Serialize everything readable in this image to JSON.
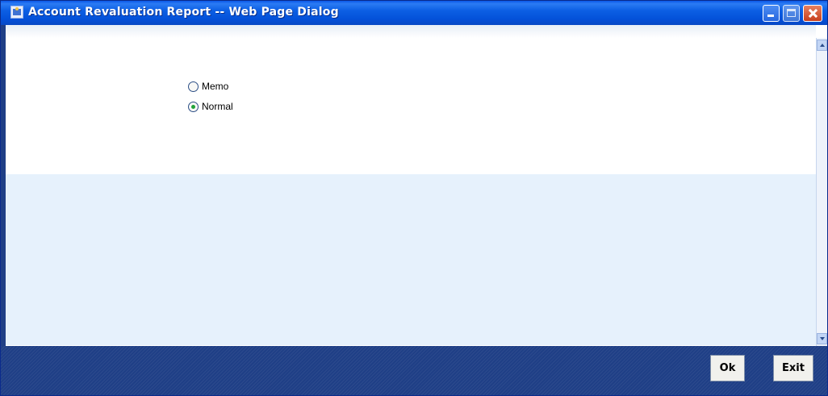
{
  "window": {
    "title": "Account Revaluation Report -- Web Page Dialog"
  },
  "options": [
    {
      "label": "Memo",
      "checked": false
    },
    {
      "label": "Normal",
      "checked": true
    }
  ],
  "footer": {
    "ok_label": "Ok",
    "exit_label": "Exit"
  },
  "colors": {
    "titlebar": "#0a58e8",
    "footer": "#1f3f86",
    "content_lower": "#e6f1fc",
    "radio_selected_dot": "#22a33a"
  },
  "icons": {
    "app": "dialog-page-icon",
    "minimize": "minimize-icon",
    "maximize": "maximize-icon",
    "close": "close-icon",
    "scroll_up": "scroll-up-arrow-icon",
    "scroll_down": "scroll-down-arrow-icon"
  }
}
